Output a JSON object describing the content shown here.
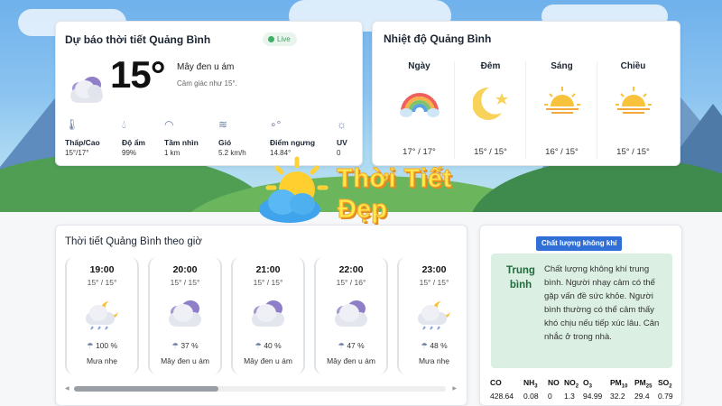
{
  "current": {
    "title": "Dự báo thời tiết Quảng Bình",
    "live": "Live",
    "temperature": "15°",
    "description": "Mây đen u ám",
    "feels_like": "Cảm giác như 15°.",
    "stats": [
      {
        "label": "Thấp/Cao",
        "value": "15°/17°",
        "icon": "thermometer-icon"
      },
      {
        "label": "Độ ẩm",
        "value": "99%",
        "icon": "humidity-icon"
      },
      {
        "label": "Tầm nhìn",
        "value": "1 km",
        "icon": "visibility-icon"
      },
      {
        "label": "Gió",
        "value": "5.2 km/h",
        "icon": "wind-icon"
      },
      {
        "label": "Điểm ngưng",
        "value": "14.84°",
        "icon": "dew-point-icon"
      },
      {
        "label": "UV",
        "value": "0",
        "icon": "uv-sun-icon"
      }
    ]
  },
  "temperature": {
    "title": "Nhiệt độ Quảng Bình",
    "periods": [
      {
        "label": "Ngày",
        "value": "17° / 17°",
        "icon": "rainbow-icon"
      },
      {
        "label": "Đêm",
        "value": "15° / 15°",
        "icon": "moon-icon"
      },
      {
        "label": "Sáng",
        "value": "16° / 15°",
        "icon": "sunrise-icon"
      },
      {
        "label": "Chiều",
        "value": "15° / 15°",
        "icon": "sunset-icon"
      }
    ]
  },
  "logo": {
    "line1": "Thời Tiết",
    "line2": "Đẹp"
  },
  "hourly": {
    "title": "Thời tiết Quảng Bình theo giờ",
    "items": [
      {
        "time": "19:00",
        "range": "15° / 15°",
        "precip": "100 %",
        "desc": "Mưa nhẹ",
        "icon": "moon-cloud-rain-icon"
      },
      {
        "time": "20:00",
        "range": "15° / 15°",
        "precip": "37 %",
        "desc": "Mây đen u ám",
        "icon": "overcast-cloud-icon"
      },
      {
        "time": "21:00",
        "range": "15° / 15°",
        "precip": "40 %",
        "desc": "Mây đen u ám",
        "icon": "overcast-cloud-icon"
      },
      {
        "time": "22:00",
        "range": "15° / 16°",
        "precip": "47 %",
        "desc": "Mây đen u ám",
        "icon": "overcast-cloud-icon"
      },
      {
        "time": "23:00",
        "range": "15° / 15°",
        "precip": "48 %",
        "desc": "Mưa nhẹ",
        "icon": "moon-cloud-rain-icon"
      }
    ]
  },
  "air": {
    "tag": "Chất lượng không khí",
    "level": "Trung bình",
    "message": "Chất lượng không khí trung bình. Người nhạy cảm có thể gặp vấn đề sức khỏe. Người bình thường có thể cảm thấy khó chịu nếu tiếp xúc lâu. Cân nhắc ở trong nhà.",
    "pollutants": [
      {
        "name": "CO",
        "sub": "",
        "value": "428.64"
      },
      {
        "name": "NH",
        "sub": "3",
        "value": "0.08"
      },
      {
        "name": "NO",
        "sub": "",
        "value": "0"
      },
      {
        "name": "NO",
        "sub": "2",
        "value": "1.3"
      },
      {
        "name": "O",
        "sub": "3",
        "value": "94.99"
      },
      {
        "name": "PM",
        "sub": "10",
        "value": "32.2"
      },
      {
        "name": "PM",
        "sub": "25",
        "value": "29.4"
      },
      {
        "name": "SO",
        "sub": "2",
        "value": "0.79"
      }
    ]
  }
}
